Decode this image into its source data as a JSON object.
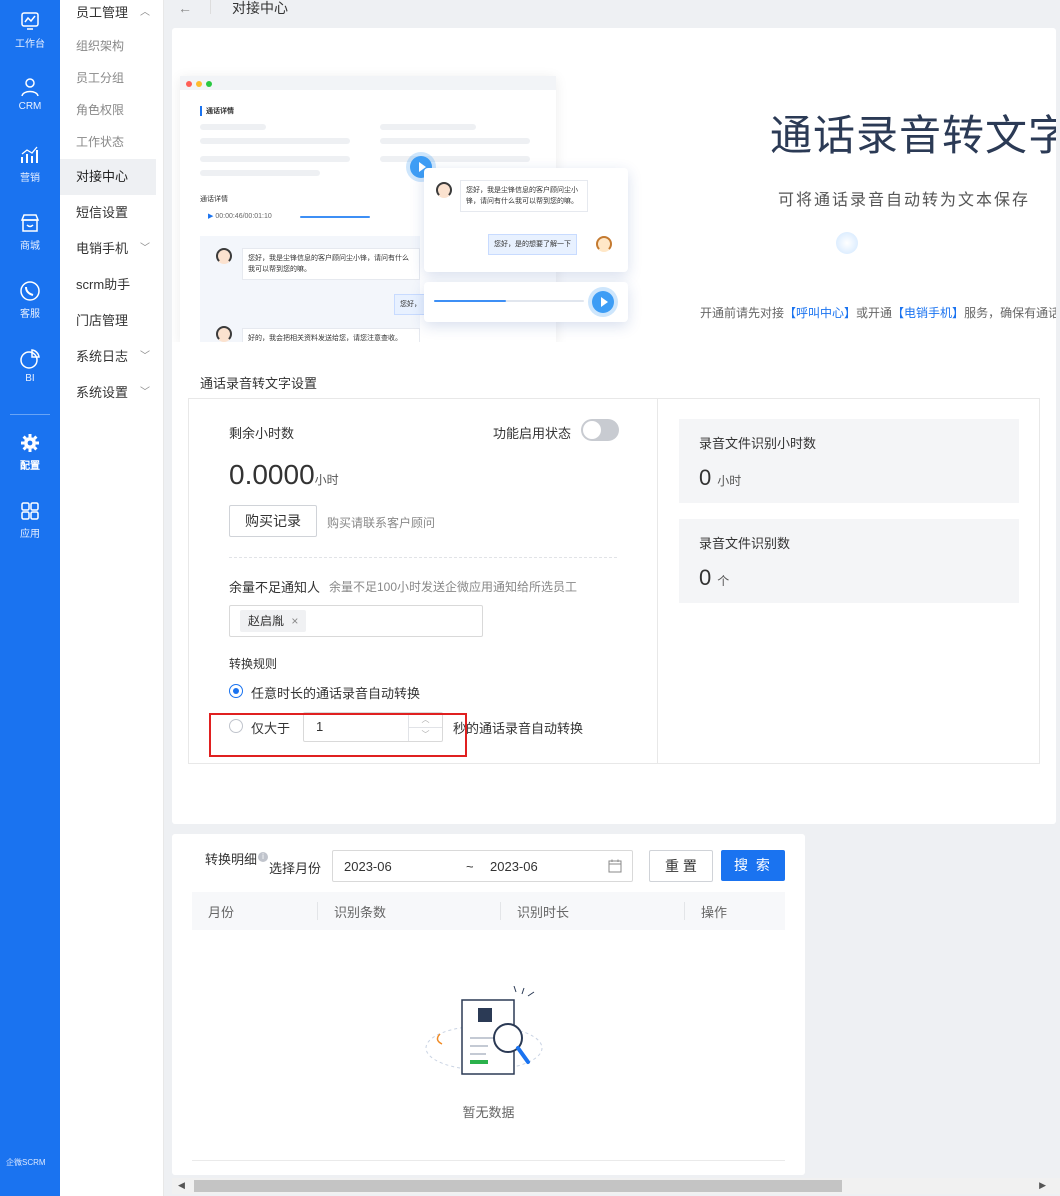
{
  "rail": {
    "items": [
      {
        "label": "工作台",
        "icon": "dashboard-icon"
      },
      {
        "label": "CRM",
        "icon": "user-icon"
      },
      {
        "label": "营销",
        "icon": "chart-bars-icon"
      },
      {
        "label": "商城",
        "icon": "store-icon"
      },
      {
        "label": "客服",
        "icon": "phone-chat-icon"
      },
      {
        "label": "BI",
        "icon": "pie-chart-icon"
      },
      {
        "label": "配置",
        "icon": "gear-icon"
      },
      {
        "label": "应用",
        "icon": "apps-grid-icon"
      }
    ],
    "logo": "企微SCRM"
  },
  "subnav": {
    "group": "员工管理",
    "items": [
      "组织架构",
      "员工分组",
      "角色权限",
      "工作状态",
      "对接中心",
      "短信设置",
      "电销手机",
      "scrm助手",
      "门店管理",
      "系统日志",
      "系统设置"
    ]
  },
  "topbar": {
    "back": "←",
    "title": "对接中心"
  },
  "hero": {
    "title": "通话录音转文字",
    "subtitle": "可将通话录音自动转为文本保存",
    "note_pre": "开通前请先对接",
    "note_link1": "【呼叫中心】",
    "note_mid": "或开通",
    "note_link2": "【电销手机】",
    "note_post": "服务，确保有通话",
    "mock": {
      "heading": "通话详情",
      "sub_heading": "通话详情",
      "time": "00:00:46/00:01:10",
      "bubble1": "您好，我是尘锋信息的客户顾问尘小锋，请问有什么我可以帮到您的嘛。",
      "bubble2": "您好，是的想要了解一下",
      "bubble3": "您好，我是尘锋信息的客户顾问尘小锋，请问有什么我可以帮到您的嘛。",
      "bubble4": "您好，",
      "bubble5": "好的，我会把相关资料发送给您，请您注意查收。"
    }
  },
  "settings": {
    "section_title": "通话录音转文字设置",
    "remaining_label": "剩余小时数",
    "remaining_value": "0.0000",
    "remaining_unit": "小时",
    "switch_label": "功能启用状态",
    "switch_on": false,
    "buy_button": "购买记录",
    "buy_hint": "购买请联系客户顾问",
    "notify_label": "余量不足通知人",
    "notify_hint": "余量不足100小时发送企微应用通知给所选员工",
    "notify_tag": "赵启胤",
    "rule_label": "转换规则",
    "rule_option1": "任意时长的通话录音自动转换",
    "rule_option2_pre": "仅大于",
    "rule_option2_value": "1",
    "rule_option2_post": "秒的通话录音自动转换",
    "stat1_title": "录音文件识别小时数",
    "stat1_value": "0",
    "stat1_unit": "小时",
    "stat2_title": "录音文件识别数",
    "stat2_value": "0",
    "stat2_unit": "个"
  },
  "detail": {
    "title": "转换明细",
    "month_label": "选择月份",
    "date_start": "2023-06",
    "date_sep": "~",
    "date_end": "2023-06",
    "reset_button": "重 置",
    "search_button": "搜 索",
    "columns": [
      "月份",
      "识别条数",
      "识别时长",
      "操作"
    ],
    "empty": "暂无数据"
  },
  "colors": {
    "primary": "#1a73f0",
    "highlight": "#e02020"
  }
}
